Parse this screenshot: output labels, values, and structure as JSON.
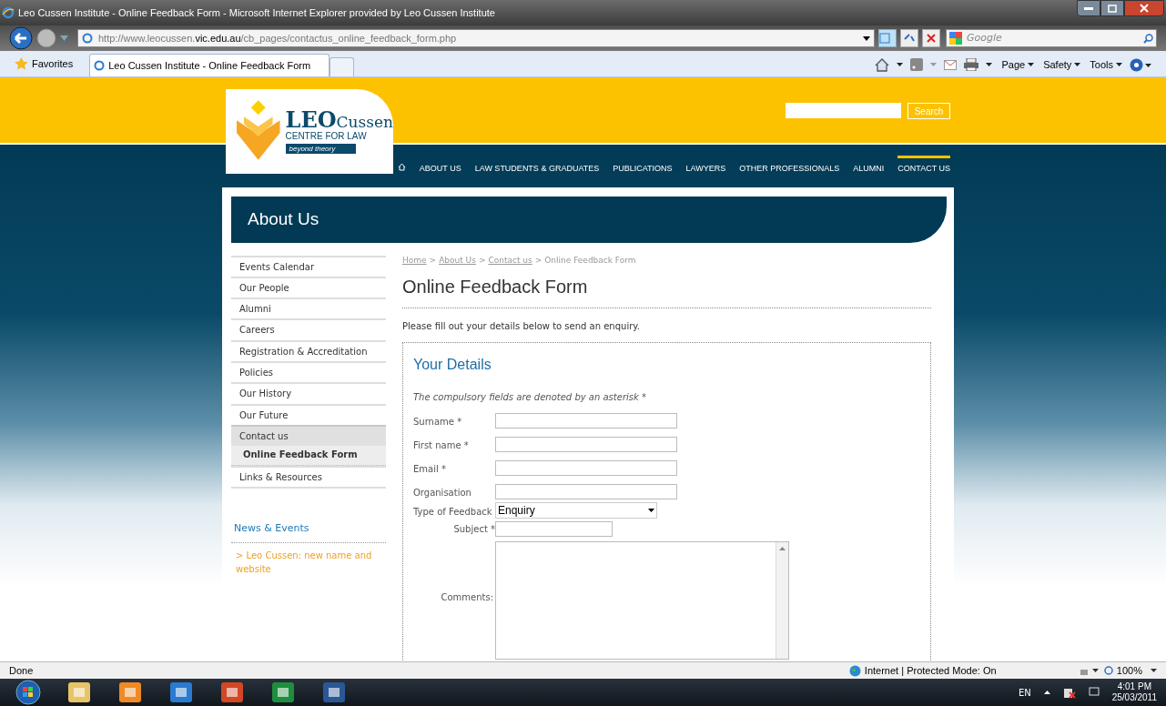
{
  "browser": {
    "title": "Leo Cussen Institute - Online Feedback Form - Microsoft Internet Explorer provided by Leo Cussen Institute",
    "url_parts": [
      {
        "text": "http://www.leocussen.",
        "strong": false
      },
      {
        "text": "vic.edu.au",
        "strong": true
      },
      {
        "text": "/cb_pages/contactus_online_feedback_form.php",
        "strong": false
      }
    ],
    "search_placeholder": "Google",
    "favorites": "Favorites",
    "tab_title": "Leo Cussen Institute - Online Feedback Form",
    "commands": [
      "Page",
      "Safety",
      "Tools"
    ]
  },
  "site": {
    "logo": {
      "leo": "LEO",
      "cussen": "Cussen",
      "centre": "CENTRE FOR LAW",
      "tagline": "beyond theory"
    },
    "search_button": "Search",
    "nav": [
      {
        "label": "ABOUT US",
        "selected": false
      },
      {
        "label": "LAW STUDENTS & GRADUATES",
        "selected": false
      },
      {
        "label": "PUBLICATIONS",
        "selected": false
      },
      {
        "label": "LAWYERS",
        "selected": false
      },
      {
        "label": "OTHER PROFESSIONALS",
        "selected": false
      },
      {
        "label": "ALUMNI",
        "selected": false
      },
      {
        "label": "CONTACT US",
        "selected": true
      }
    ],
    "banner": "About Us",
    "sidebar": [
      {
        "label": "Events Calendar",
        "selected": false
      },
      {
        "label": "Our People",
        "selected": false
      },
      {
        "label": "Alumni",
        "selected": false
      },
      {
        "label": "Careers",
        "selected": false
      },
      {
        "label": "Registration & Accreditation",
        "selected": false
      },
      {
        "label": "Policies",
        "selected": false
      },
      {
        "label": "Our History",
        "selected": false
      },
      {
        "label": "Our Future",
        "selected": false
      },
      {
        "label": "Contact us",
        "selected": true,
        "children": [
          {
            "label": "Online Feedback Form",
            "selected": true
          }
        ]
      },
      {
        "label": "Links & Resources",
        "selected": false
      }
    ],
    "news": {
      "heading": "News & Events",
      "items": [
        "> Leo Cussen: new name and website"
      ]
    },
    "breadcrumb": [
      {
        "label": "Home",
        "link": true
      },
      {
        "label": "About Us",
        "link": true
      },
      {
        "label": "Contact us",
        "link": true
      },
      {
        "label": "Online Feedback Form",
        "link": false
      }
    ],
    "breadcrumb_separator": ">",
    "page_title": "Online Feedback Form",
    "intro": "Please fill out your details below to send an enquiry.",
    "form": {
      "heading": "Your Details",
      "note": "The compulsory fields are denoted by an asterisk *",
      "fields": [
        {
          "kind": "text",
          "label": "Surname *"
        },
        {
          "kind": "text",
          "label": "First name *"
        },
        {
          "kind": "text",
          "label": "Email *"
        },
        {
          "kind": "text",
          "label": "Organisation"
        },
        {
          "kind": "select",
          "label": "Type of Feedback",
          "value": "Enquiry"
        },
        {
          "kind": "short",
          "label": "Subject *"
        },
        {
          "kind": "textarea",
          "label": "Comments:"
        }
      ]
    }
  },
  "status_bar": {
    "text": "Done",
    "zone": "Internet | Protected Mode: On",
    "zoom": "100%"
  },
  "taskbar": {
    "language": "EN",
    "time": "4:01 PM",
    "date": "25/03/2011"
  }
}
